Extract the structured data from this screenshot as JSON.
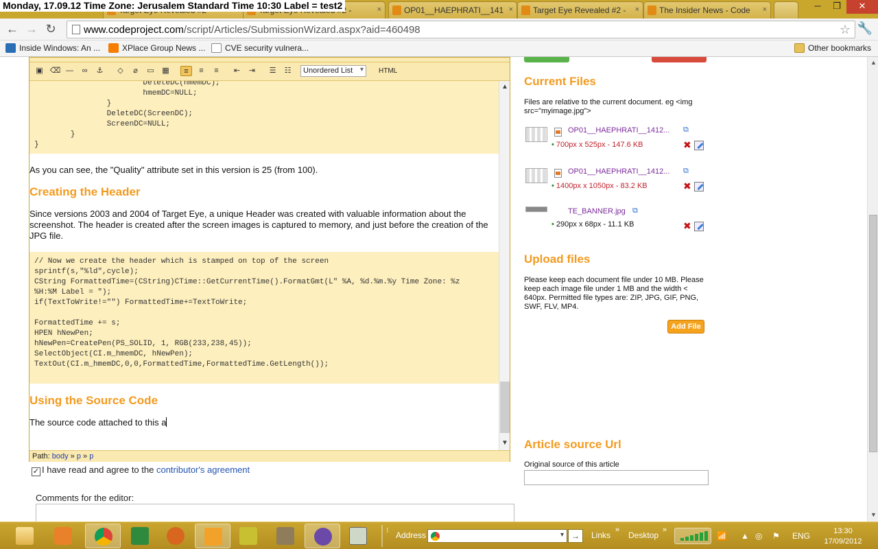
{
  "overlay_text": "Monday, 17.09.12 Time Zone: Jerusalem Standard Time 10:30 Label = test2",
  "tabs": [
    {
      "label": "Target Eye Revealed #2 -"
    },
    {
      "label": "OP01__HAEPHRATI__141"
    },
    {
      "label": "Target Eye Revealed #2 -"
    },
    {
      "label": "The Insider News - Code"
    }
  ],
  "window_controls": {
    "minimize": "─",
    "restore": "❐",
    "close": "✕"
  },
  "omnibox": {
    "url_host": "www.codeproject.com",
    "url_path": "/script/Articles/SubmissionWizard.aspx?aid=460498"
  },
  "bookmarks": [
    {
      "label": "Inside Windows: An ...",
      "color": "#2a6fb5"
    },
    {
      "label": "XPlace Group News ...",
      "color": "#f57d00"
    },
    {
      "label": "CVE security vulnera...",
      "color": "#ffffff"
    }
  ],
  "other_bookmarks": "Other bookmarks",
  "editor": {
    "toolbar_select": "Unordered List",
    "toolbar_html": "HTML",
    "code1": [
      "                        DeleteDC(hmemDC);",
      "                        hmemDC=NULL;",
      "                }",
      "                DeleteDC(ScreenDC);",
      "                ScreenDC=NULL;",
      "        }",
      "}"
    ],
    "para1": "As you can see, the \"Quality\" attribute set in this version is 25 (from 100).",
    "heading1": "Creating the Header",
    "para2": "Since versions 2003 and 2004 of Target Eye, a unique Header was created with valuable information about the screenshot. The header is created after the screen images is captured to memory, and just before the creation of the JPG file.",
    "code2": [
      "// Now we create the header which is stamped on top of the screen",
      "sprintf(s,\"%ld\",cycle);",
      "CString FormattedTime=(CString)CTime::GetCurrentTime().FormatGmt(L\" %A, %d.%m.%y Time Zone: %z",
      "%H:%M Label = \");",
      "if(TextToWrite!=\"\") FormattedTime+=TextToWrite;",
      "",
      "FormattedTime += s;",
      "HPEN hNewPen;",
      "hNewPen=CreatePen(PS_SOLID, 1, RGB(233,238,45));",
      "SelectObject(CI.m_hmemDC, hNewPen);",
      "TextOut(CI.m_hmemDC,0,0,FormattedTime,FormattedTime.GetLength());"
    ],
    "heading2": "Using the Source Code",
    "para3": "The source code attached to this a",
    "path_label": "Path:",
    "path_items": [
      "body",
      "p",
      "p"
    ]
  },
  "agreement": {
    "checked": "✓",
    "text": "I have read and agree to the ",
    "link": "contributor's agreement"
  },
  "comments_label": "Comments for the editor:",
  "right": {
    "current_files_title": "Current Files",
    "current_files_note": "Files are relative to the current document. eg <img src=\"myimage.jpg\">",
    "files": [
      {
        "name": "OP01__HAEPHRATI__1412...",
        "meta": "700px x 525px - 147.6 KB",
        "meta_color": "#c0202a"
      },
      {
        "name": "OP01__HAEPHRATI__1412...",
        "meta": "1400px x 1050px - 83.2 KB",
        "meta_color": "#c0202a"
      },
      {
        "name": "TE_BANNER.jpg",
        "meta": "290px x 68px - 11.1 KB",
        "meta_color": "#111111"
      }
    ],
    "upload_title": "Upload files",
    "upload_note": "Please keep each document file under 10 MB. Please keep each image file under 1 MB and the width < 640px. Permitted file types are: ZIP, JPG, GIF, PNG, SWF, FLV, MP4.",
    "add_file": "Add File",
    "source_title": "Article source Url",
    "source_label": "Original source of this article"
  },
  "taskbar": {
    "address_label": "Address",
    "links_label": "Links",
    "desktop_label": "Desktop",
    "lang": "ENG",
    "time": "13:30",
    "date": "17/09/2012"
  }
}
